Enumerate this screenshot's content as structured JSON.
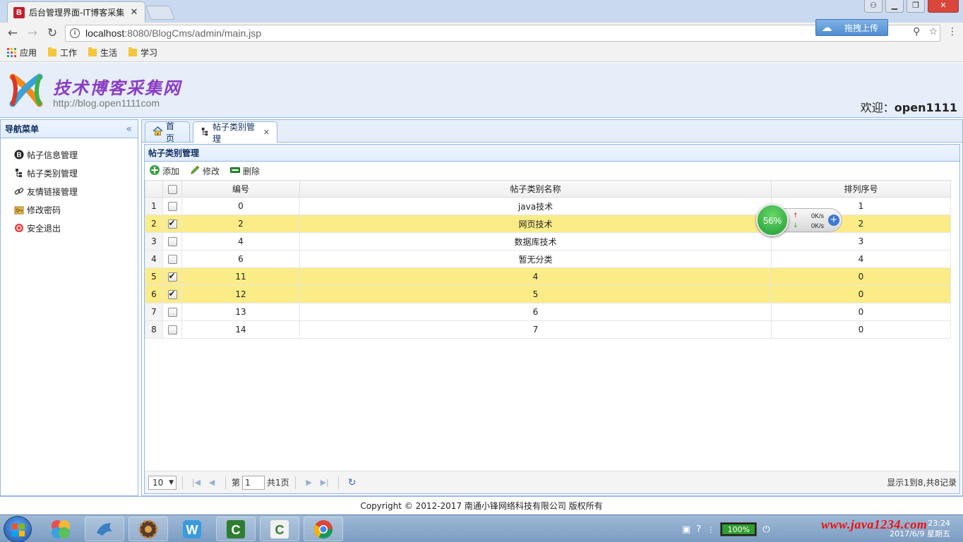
{
  "browser": {
    "tab_title": "后台管理界面-IT博客采集",
    "favicon_letter": "B",
    "url_host": "localhost",
    "url_path": ":8080/BlogCms/admin/main.jsp",
    "extension_label": "拖拽上传",
    "bookmarks": [
      "应用",
      "工作",
      "生活",
      "学习"
    ]
  },
  "header": {
    "site_title": "技术博客采集网",
    "site_url": "http://blog.open1111com",
    "welcome_label": "欢迎：",
    "username": "open1111"
  },
  "nav": {
    "title": "导航菜单",
    "items": [
      "帖子信息管理",
      "帖子类别管理",
      "友情链接管理",
      "修改密码",
      "安全退出"
    ]
  },
  "tabs": [
    {
      "label": "首页"
    },
    {
      "label": "帖子类别管理"
    }
  ],
  "grid": {
    "title": "帖子类别管理",
    "toolbar": {
      "add": "添加",
      "edit": "修改",
      "delete": "删除"
    },
    "columns": [
      "编号",
      "帖子类别名称",
      "排列序号"
    ],
    "rows": [
      {
        "rn": "1",
        "checked": false,
        "id": "0",
        "name": "java技术",
        "order": "1"
      },
      {
        "rn": "2",
        "checked": true,
        "id": "2",
        "name": "网页技术",
        "order": "2"
      },
      {
        "rn": "3",
        "checked": false,
        "id": "4",
        "name": "数据库技术",
        "order": "3"
      },
      {
        "rn": "4",
        "checked": false,
        "id": "6",
        "name": "暂无分类",
        "order": "4"
      },
      {
        "rn": "5",
        "checked": true,
        "id": "11",
        "name": "4",
        "order": "0"
      },
      {
        "rn": "6",
        "checked": true,
        "id": "12",
        "name": "5",
        "order": "0"
      },
      {
        "rn": "7",
        "checked": false,
        "id": "13",
        "name": "6",
        "order": "0"
      },
      {
        "rn": "8",
        "checked": false,
        "id": "14",
        "name": "7",
        "order": "0"
      }
    ],
    "pager": {
      "page_size": "10",
      "page_prefix": "第",
      "page_value": "1",
      "page_total": "共1页",
      "info": "显示1到8,共8记录"
    }
  },
  "netmon": {
    "percent": "56%",
    "up": "0K/s",
    "down": "0K/s"
  },
  "footer": "Copyright © 2012-2017 南通小锋网络科技有限公司 版权所有",
  "taskbar": {
    "battery": "100%",
    "watermark": "www.java1234.com",
    "time": "23:24",
    "date": "2017/6/9 星期五"
  },
  "colors": {
    "selected_row": "#fbec88",
    "panel_border": "#95b8e7",
    "header_bg": "#e6eef9",
    "title_purple": "#8a3cc2"
  }
}
